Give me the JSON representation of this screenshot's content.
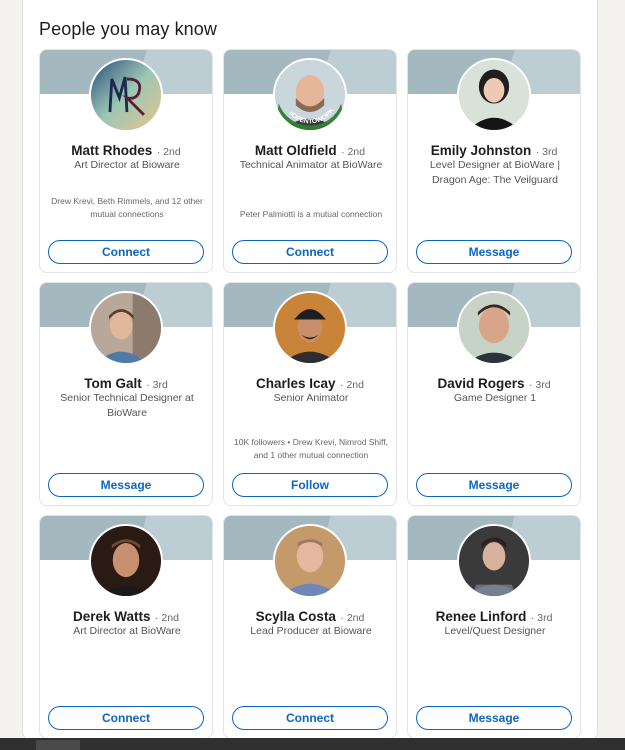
{
  "section": {
    "title": "People you may know"
  },
  "colors": {
    "accent": "#0a66c2",
    "banner": "#bccdd3"
  },
  "people": [
    {
      "name": "Matt Rhodes",
      "degree": "· 2nd",
      "headline": "Art Director at Bioware",
      "mutual": "Drew Krevi, Beth Rimmels, and 12 other mutual connections",
      "action": "Connect",
      "avatar_icon": "mr-logo-avatar"
    },
    {
      "name": "Matt Oldfield",
      "degree": "· 2nd",
      "headline": "Technical Animator at BioWare",
      "mutual": "Peter Palmiotti is a mutual connection",
      "action": "Connect",
      "avatar_icon": "opentowork-avatar",
      "badge": "#OPENTOWORK"
    },
    {
      "name": "Emily Johnston",
      "degree": "· 3rd",
      "headline": "Level Designer at BioWare | Dragon Age: The Veilguard",
      "mutual": "",
      "action": "Message",
      "avatar_icon": "person-avatar"
    },
    {
      "name": "Tom Galt",
      "degree": "· 3rd",
      "headline": "Senior Technical Designer at BioWare",
      "mutual": "",
      "action": "Message",
      "avatar_icon": "person-avatar"
    },
    {
      "name": "Charles Icay",
      "degree": "· 2nd",
      "headline": "Senior Animator",
      "mutual": "10K followers • Drew Krevi, Nimrod Shiff, and 1 other mutual connection",
      "action": "Follow",
      "avatar_icon": "person-avatar"
    },
    {
      "name": "David Rogers",
      "degree": "· 3rd",
      "headline": "Game Designer 1",
      "mutual": "",
      "action": "Message",
      "avatar_icon": "person-avatar"
    },
    {
      "name": "Derek Watts",
      "degree": "· 2nd",
      "headline": "Art Director at BioWare",
      "mutual": "",
      "action": "Connect",
      "avatar_icon": "person-avatar"
    },
    {
      "name": "Scylla Costa",
      "degree": "· 2nd",
      "headline": "Lead Producer at Bioware",
      "mutual": "",
      "action": "Connect",
      "avatar_icon": "person-avatar"
    },
    {
      "name": "Renee Linford",
      "degree": "· 3rd",
      "headline": "Level/Quest Designer",
      "mutual": "",
      "action": "Message",
      "avatar_icon": "person-avatar"
    }
  ]
}
